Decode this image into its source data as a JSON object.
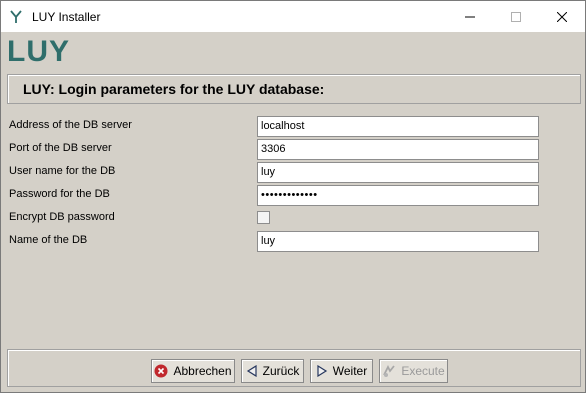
{
  "window": {
    "title": "LUY Installer",
    "minimize_icon": "minimize-icon",
    "maximize_icon": "maximize-icon",
    "close_icon": "close-icon"
  },
  "logo": {
    "text": "LUY",
    "color": "#2f6e6b"
  },
  "header": {
    "title": "LUY: Login parameters for the LUY database:"
  },
  "form": {
    "fields": [
      {
        "label": "Address of the DB server",
        "value": "localhost"
      },
      {
        "label": "Port of the DB server",
        "value": "3306"
      },
      {
        "label": "User name for the DB",
        "value": "luy"
      },
      {
        "label": "Password for the DB",
        "value": "•••••••••••••"
      },
      {
        "label": "Encrypt DB password",
        "checked": false
      },
      {
        "label": "Name of the DB",
        "value": "luy"
      }
    ]
  },
  "buttons": {
    "cancel": {
      "label": "Abbrechen",
      "icon": "cancel-icon"
    },
    "back": {
      "label": "Zurück",
      "icon": "arrow-left-icon"
    },
    "next": {
      "label": "Weiter",
      "icon": "arrow-right-icon"
    },
    "execute": {
      "label": "Execute",
      "icon": "execute-icon",
      "enabled": false
    }
  }
}
